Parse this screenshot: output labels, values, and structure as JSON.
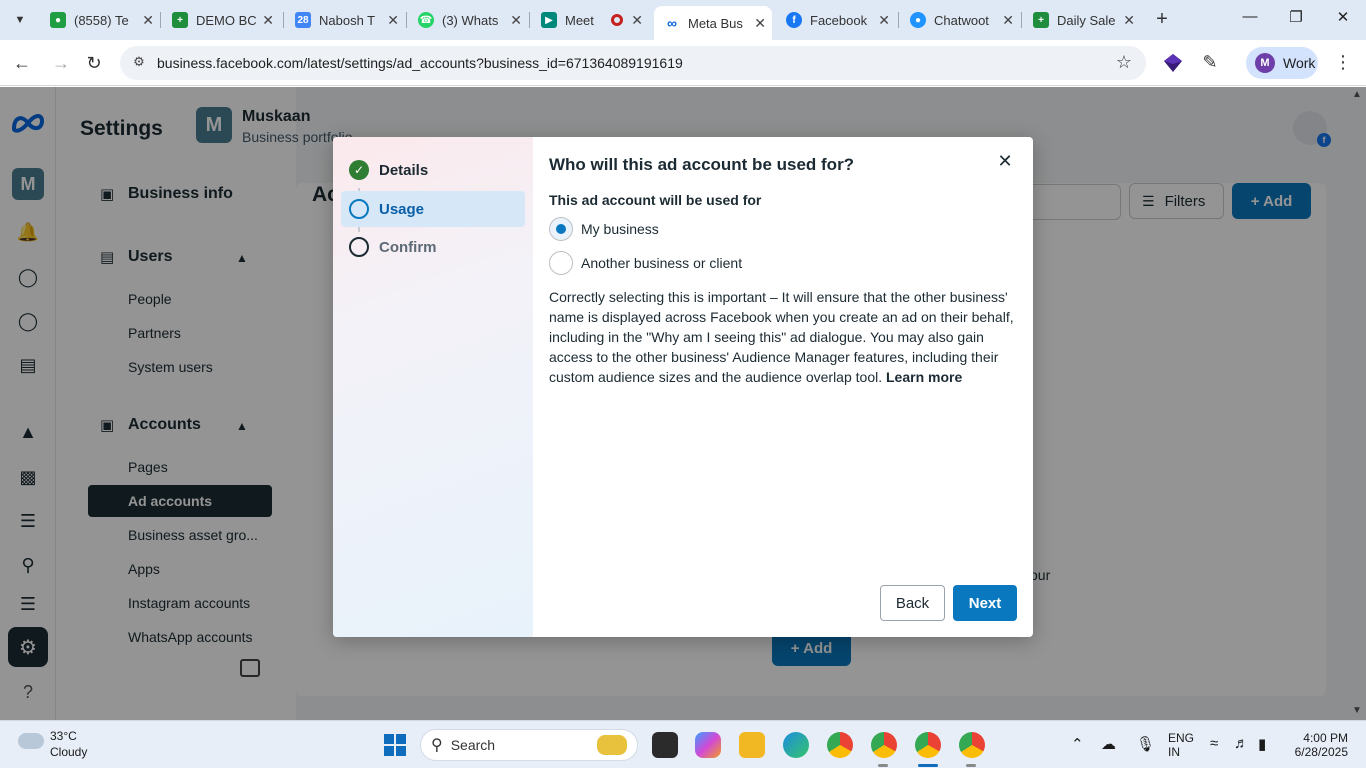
{
  "browser": {
    "tabs": [
      {
        "title": "(8558) Te",
        "favicon": "chat-icon",
        "color": "#1f9e44"
      },
      {
        "title": "DEMO BC",
        "favicon": "sheets-icon",
        "color": "#1e8e3e"
      },
      {
        "title": "Nabosh T",
        "favicon": "calendar-icon",
        "color": "#4285f4"
      },
      {
        "title": "(3) Whats",
        "favicon": "whatsapp-icon",
        "color": "#25d366"
      },
      {
        "title": "Meet",
        "favicon": "meet-icon",
        "color": "#00897b"
      },
      {
        "title": "Meta Bus",
        "favicon": "meta-icon",
        "color": "#0668e1"
      },
      {
        "title": "Facebook",
        "favicon": "facebook-icon",
        "color": "#1877f2"
      },
      {
        "title": "Chatwoot",
        "favicon": "chatwoot-icon",
        "color": "#1f93ff"
      },
      {
        "title": "Daily Sale",
        "favicon": "sheets-icon",
        "color": "#1e8e3e"
      }
    ],
    "active_tab_index": 5,
    "url": "business.facebook.com/latest/settings/ad_accounts?business_id=671364089191619",
    "profile_label": "Work",
    "profile_initial": "M"
  },
  "rail": {
    "workspace_initial": "M"
  },
  "sidenav": {
    "title": "Settings",
    "business_info": "Business info",
    "users_head": "Users",
    "users_items": [
      "People",
      "Partners",
      "System users"
    ],
    "accounts_head": "Accounts",
    "accounts_items": [
      "Pages",
      "Ad accounts",
      "Business asset gro...",
      "Apps",
      "Instagram accounts",
      "WhatsApp accounts"
    ],
    "active_item": "Ad accounts"
  },
  "portfolio": {
    "initial": "M",
    "name": "Muskaan",
    "subtitle": "Business portfolio"
  },
  "background": {
    "heading": "Ac",
    "filters_label": "Filters",
    "add_label": "+ Add",
    "your_fragment": "our"
  },
  "modal": {
    "steps": [
      {
        "label": "Details",
        "state": "done"
      },
      {
        "label": "Usage",
        "state": "current"
      },
      {
        "label": "Confirm",
        "state": "todo"
      }
    ],
    "title": "Who will this ad account be used for?",
    "used_for_label": "This ad account will be used for",
    "options": [
      {
        "label": "My business",
        "checked": true
      },
      {
        "label": "Another business or client",
        "checked": false
      }
    ],
    "description": "Correctly selecting this is important – It will ensure that the other business' name is displayed across Facebook when you create an ad on their behalf, including in the \"Why am I seeing this\" ad dialogue. You may also gain access to the other business' Audience Manager features, including their custom audience sizes and the audience overlap tool.",
    "learn_more": "Learn more",
    "back_label": "Back",
    "next_label": "Next"
  },
  "taskbar": {
    "temperature": "33°C",
    "condition": "Cloudy",
    "search_placeholder": "Search",
    "lang_line1": "ENG",
    "lang_line2": "IN",
    "time": "4:00 PM",
    "date": "6/28/2025"
  },
  "colors": {
    "primary_blue": "#0a78be",
    "nav_dark": "#1c2b33",
    "portfolio_teal": "#4a7f92"
  }
}
